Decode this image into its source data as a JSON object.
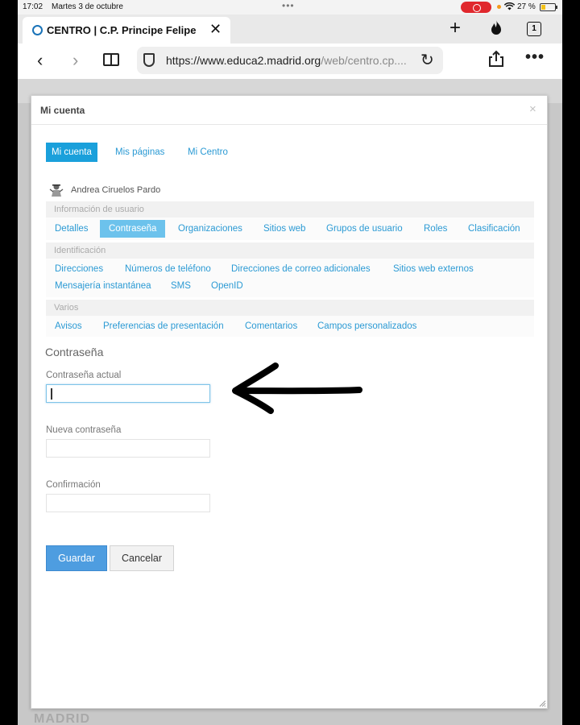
{
  "status_bar": {
    "time": "17:02",
    "date": "Martes 3 de octubre",
    "dots": "•••",
    "battery": "27 %"
  },
  "browser": {
    "tab_title": "CENTRO | C.P. Principe Felipe |",
    "tab_count": "1",
    "url_main": "https://www.educa2.madrid.org",
    "url_path": "/web/centro.cp...."
  },
  "backdrop": {
    "footer_text": "MADRID"
  },
  "modal": {
    "title": "Mi cuenta",
    "close": "×",
    "top_tabs": [
      "Mi cuenta",
      "Mis páginas",
      "Mi Centro"
    ],
    "user_name": "Andrea Ciruelos Pardo",
    "sections": {
      "user_info": {
        "header": "Información de usuario",
        "links": [
          "Detalles",
          "Contraseña",
          "Organizaciones",
          "Sitios web",
          "Grupos de usuario",
          "Roles",
          "Clasificación"
        ]
      },
      "identification": {
        "header": "Identificación",
        "links": [
          "Direcciones",
          "Números de teléfono",
          "Direcciones de correo adicionales",
          "Sitios web externos",
          "Mensajería instantánea",
          "SMS",
          "OpenID"
        ]
      },
      "misc": {
        "header": "Varios",
        "links": [
          "Avisos",
          "Preferencias de presentación",
          "Comentarios",
          "Campos personalizados"
        ]
      }
    },
    "form": {
      "title": "Contraseña",
      "current_label": "Contraseña actual",
      "current_value": "",
      "new_label": "Nueva contraseña",
      "new_value": "",
      "confirm_label": "Confirmación",
      "confirm_value": "",
      "save_label": "Guardar",
      "cancel_label": "Cancelar"
    }
  },
  "colors": {
    "accent": "#1aa0db",
    "link": "#2b9ad4",
    "save_button": "#4e9de0",
    "record_pill": "#e0282d"
  }
}
